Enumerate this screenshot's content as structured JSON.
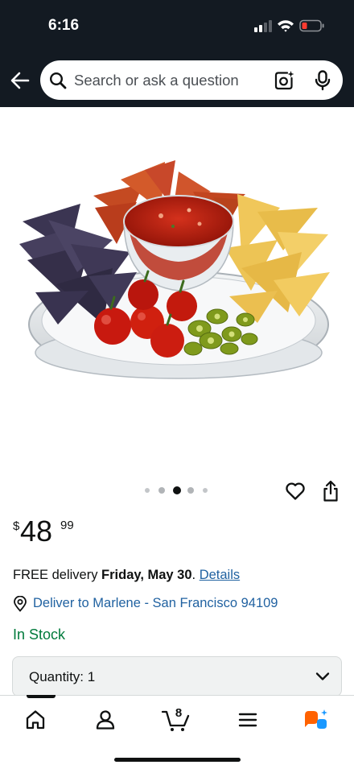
{
  "status_bar": {
    "time": "6:16",
    "battery_color": "#ff3b30"
  },
  "search": {
    "placeholder": "Search or ask a question",
    "icons": [
      "back-arrow-icon",
      "search-icon",
      "camera-lens-icon",
      "microphone-icon"
    ]
  },
  "product": {
    "image_alt": "Serving tray with tortilla chips, salsa, cherry tomatoes and jalapeños",
    "carousel": {
      "total_images": 5,
      "active_index": 2
    },
    "price": {
      "symbol": "$",
      "whole": "48",
      "fraction": "99"
    }
  },
  "delivery": {
    "prefix": "FREE delivery ",
    "date": "Friday, May 30",
    "suffix": ". ",
    "details_link": "Details"
  },
  "location": {
    "label": "Deliver to Marlene - San Francisco 94109"
  },
  "stock": {
    "label": "In Stock"
  },
  "quantity": {
    "label": "Quantity: 1"
  },
  "nav": {
    "items": [
      "home-icon",
      "account-icon",
      "cart-icon",
      "menu-icon",
      "rufus-ai-icon"
    ],
    "cart_count": "8"
  },
  "colors": {
    "header": "#131a22",
    "link": "#2162a1",
    "in_stock": "#007a3b",
    "assistant_orange": "#ff6200",
    "assistant_blue": "#1a98ff"
  }
}
